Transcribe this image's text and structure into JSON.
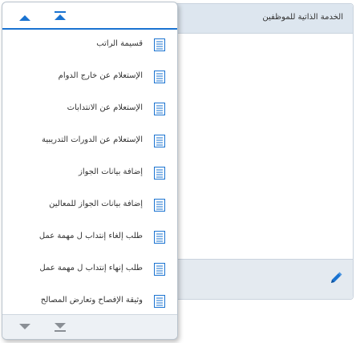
{
  "background_panel": {
    "title": "الخدمة الذاتية للموظفين",
    "edit_icon": "pencil-icon"
  },
  "dropdown": {
    "scroll_up_icon": "arrow-up-icon",
    "scroll_top_icon": "arrow-up-to-top-icon",
    "scroll_down_icon": "arrow-down-icon",
    "scroll_bottom_icon": "arrow-down-to-bottom-icon",
    "item_icon": "document-icon",
    "items": [
      {
        "label": "قسيمة الراتب"
      },
      {
        "label": "الإستعلام عن خارج الدوام"
      },
      {
        "label": "الإستعلام عن الانتدابات"
      },
      {
        "label": "الإستعلام عن الدورات التدريبية"
      },
      {
        "label": "إضافة بيانات الجواز"
      },
      {
        "label": "إضافة بيانات الجواز للمعالين"
      },
      {
        "label": "طلب إلغاء إنتداب ل مهمة عمل"
      },
      {
        "label": "طلب إنهاء إنتداب ل مهمة عمل"
      },
      {
        "label": "وثيقة الإفصاح وتعارض المصالح"
      }
    ]
  },
  "colors": {
    "accent": "#1a73d1",
    "arrow_gray": "#8a8f95",
    "panel_header": "#dde6ef"
  }
}
